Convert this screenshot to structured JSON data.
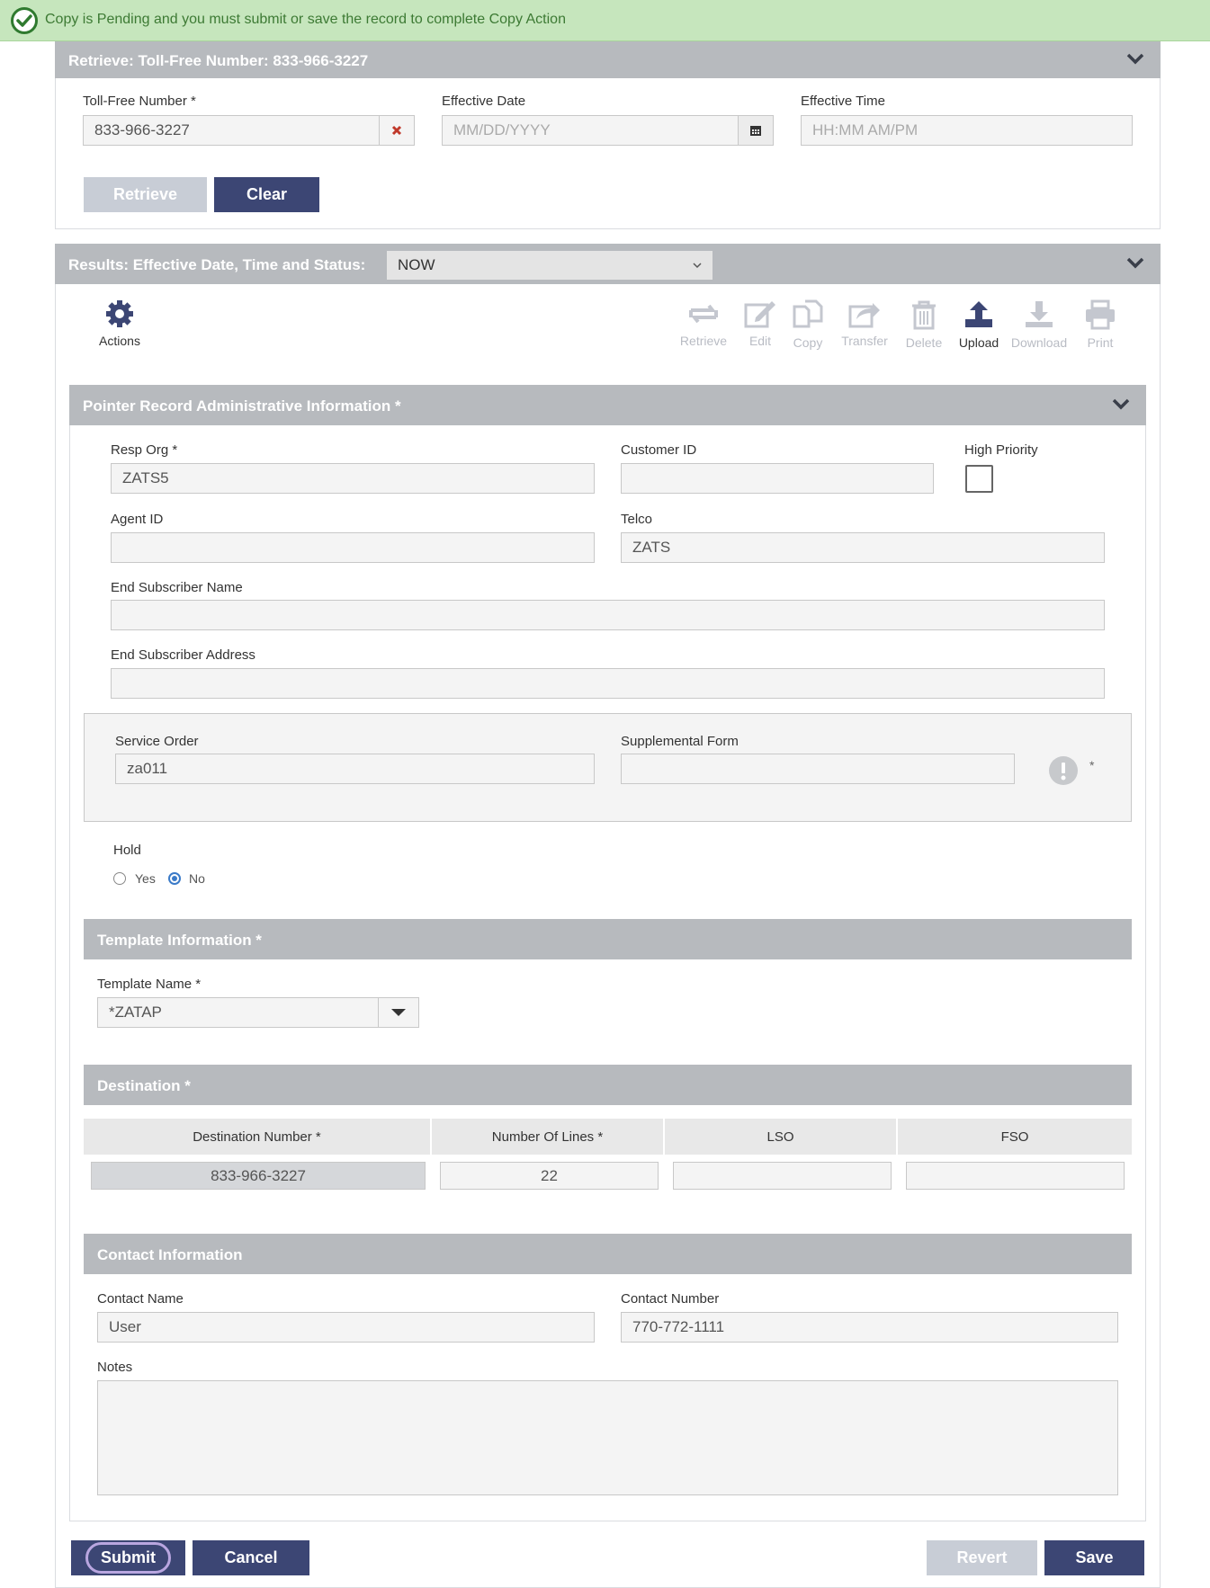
{
  "alert": {
    "message": "Copy is Pending and you must submit or save the record to complete Copy Action"
  },
  "retrieve_panel": {
    "title": "Retrieve: Toll-Free Number: 833-966-3227",
    "tfn_label": "Toll-Free Number *",
    "tfn_value": "833-966-3227",
    "date_label": "Effective Date",
    "date_placeholder": "MM/DD/YYYY",
    "time_label": "Effective Time",
    "time_placeholder": "HH:MM AM/PM",
    "retrieve_button": "Retrieve",
    "clear_button": "Clear"
  },
  "results_panel": {
    "title": "Results: Effective Date, Time and Status:",
    "status_selected": "NOW",
    "actions_label": "Actions",
    "toolbar": {
      "retrieve": "Retrieve",
      "edit": "Edit",
      "copy": "Copy",
      "transfer": "Transfer",
      "delete": "Delete",
      "upload": "Upload",
      "download": "Download",
      "print": "Print"
    }
  },
  "admin_section": {
    "title": "Pointer Record Administrative Information *",
    "resp_org_label": "Resp Org *",
    "resp_org_value": "ZATS5",
    "customer_id_label": "Customer ID",
    "customer_id_value": "",
    "high_priority_label": "High Priority",
    "agent_id_label": "Agent ID",
    "agent_id_value": "",
    "telco_label": "Telco",
    "telco_value": "ZATS",
    "end_sub_name_label": "End Subscriber Name",
    "end_sub_name_value": "",
    "end_sub_addr_label": "End Subscriber Address",
    "end_sub_addr_value": "",
    "service_order_label": "Service Order",
    "service_order_value": "za011",
    "supp_form_label": "Supplemental Form",
    "supp_form_value": "",
    "supp_required_mark": "*",
    "hold_label": "Hold",
    "hold_yes": "Yes",
    "hold_no": "No"
  },
  "template_section": {
    "title": "Template Information *",
    "name_label": "Template Name *",
    "name_value": "*ZATAP"
  },
  "destination_section": {
    "title": "Destination *",
    "headers": [
      "Destination Number *",
      "Number Of Lines *",
      "LSO",
      "FSO"
    ],
    "row": {
      "number": "833-966-3227",
      "lines": "22",
      "lso": "",
      "fso": ""
    }
  },
  "contact_section": {
    "title": "Contact Information",
    "name_label": "Contact Name",
    "name_value": "User",
    "number_label": "Contact Number",
    "number_value": "770-772-1111",
    "notes_label": "Notes",
    "notes_value": ""
  },
  "footer": {
    "submit": "Submit",
    "cancel": "Cancel",
    "revert": "Revert",
    "save": "Save"
  },
  "colors": {
    "primary_button": "#3c4674",
    "disabled_button": "#c8cdd6",
    "section_bar": "#b7babe",
    "alert_bg": "#c6e6bd"
  }
}
